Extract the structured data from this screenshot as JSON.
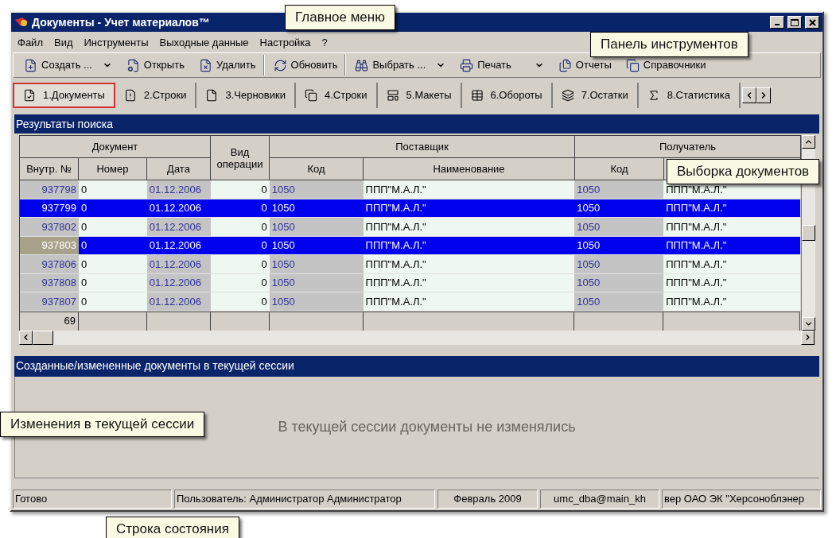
{
  "window": {
    "title": "Документы - Учет материалов™"
  },
  "menu": [
    "Файл",
    "Вид",
    "Инструменты",
    "Выходные данные",
    "Настройка",
    "?"
  ],
  "toolbar": [
    {
      "kind": "create",
      "label": "Создать ...",
      "dropdown": true,
      "separator_after": false
    },
    {
      "kind": "open",
      "label": "Открыть",
      "dropdown": false,
      "separator_after": false
    },
    {
      "kind": "delete",
      "label": "Удалить",
      "dropdown": false,
      "separator_after": true
    },
    {
      "kind": "refresh",
      "label": "Обновить",
      "dropdown": false,
      "separator_after": true
    },
    {
      "kind": "select",
      "label": "Выбрать ...",
      "dropdown": true,
      "separator_after": false
    },
    {
      "kind": "print",
      "label": "Печать",
      "dropdown": true,
      "separator_after": false
    },
    {
      "kind": "reports",
      "label": "Отчеты",
      "dropdown": false,
      "separator_after": false
    },
    {
      "kind": "directories",
      "label": "Справочники",
      "dropdown": false,
      "separator_after": false
    }
  ],
  "tabs": [
    {
      "kind": "check",
      "label": "1.Документы",
      "selected": true
    },
    {
      "kind": "alert",
      "label": "2.Строки",
      "selected": false
    },
    {
      "kind": "blank",
      "label": "3.Черновики",
      "selected": false
    },
    {
      "kind": "windows",
      "label": "4.Строки",
      "selected": false
    },
    {
      "kind": "layout",
      "label": "5.Макеты",
      "selected": false
    },
    {
      "kind": "grid",
      "label": "6.Обороты",
      "selected": false
    },
    {
      "kind": "stack",
      "label": "7.Остатки",
      "selected": false
    },
    {
      "kind": "sigma",
      "label": "8.Статистика",
      "selected": false
    }
  ],
  "results": {
    "title": "Результаты поиска",
    "groups": [
      "Документ",
      "Вид операции",
      "Поставщик",
      "Получатель"
    ],
    "columns": [
      "Внутр. №",
      "Номер",
      "Дата",
      "Код",
      "Наименование",
      "Код"
    ],
    "rows": [
      {
        "cells": [
          "937798",
          "0",
          "01.12.2006",
          "0",
          "1050",
          "ППП\"М.А.Л.\"",
          "1050",
          "ППП\"М.А.Л.\""
        ],
        "selected": false,
        "focused": false
      },
      {
        "cells": [
          "937799",
          "0",
          "01.12.2006",
          "0",
          "1050",
          "ППП\"М.А.Л.\"",
          "1050",
          "ППП\"М.А.Л.\""
        ],
        "selected": true,
        "focused": false
      },
      {
        "cells": [
          "937802",
          "0",
          "01.12.2006",
          "0",
          "1050",
          "ППП\"М.А.Л.\"",
          "1050",
          "ППП\"М.А.Л.\""
        ],
        "selected": false,
        "focused": false
      },
      {
        "cells": [
          "937803",
          "0",
          "01.12.2006",
          "0",
          "1050",
          "ППП\"М.А.Л.\"",
          "1050",
          "ППП\"М.А.Л.\""
        ],
        "selected": true,
        "focused": true
      },
      {
        "cells": [
          "937806",
          "0",
          "01.12.2006",
          "0",
          "1050",
          "ППП\"М.А.Л.\"",
          "1050",
          "ППП\"М.А.Л.\""
        ],
        "selected": false,
        "focused": false
      },
      {
        "cells": [
          "937808",
          "0",
          "01.12.2006",
          "0",
          "1050",
          "ППП\"М.А.Л.\"",
          "1050",
          "ППП\"М.А.Л.\""
        ],
        "selected": false,
        "focused": false
      },
      {
        "cells": [
          "937807",
          "0",
          "01.12.2006",
          "0",
          "1050",
          "ППП\"М.А.Л.\"",
          "1050",
          "ППП\"М.А.Л.\""
        ],
        "selected": false,
        "focused": false
      }
    ],
    "footer": "69"
  },
  "session": {
    "title": "Созданные/измененные документы в текущей сессии",
    "empty_message": "В текущей сессии документы не изменялись"
  },
  "status_bar": [
    "Готово",
    "Пользователь: Администратор Администратор",
    "Февраль 2009",
    "umc_dba@main_kh",
    "вер ОАО ЭК \"Херсоноблэнер"
  ],
  "callouts": [
    "Главное меню",
    "Панель инструментов",
    "Выборка документов",
    "Изменения в текущей сессии",
    "Строка состояния"
  ]
}
